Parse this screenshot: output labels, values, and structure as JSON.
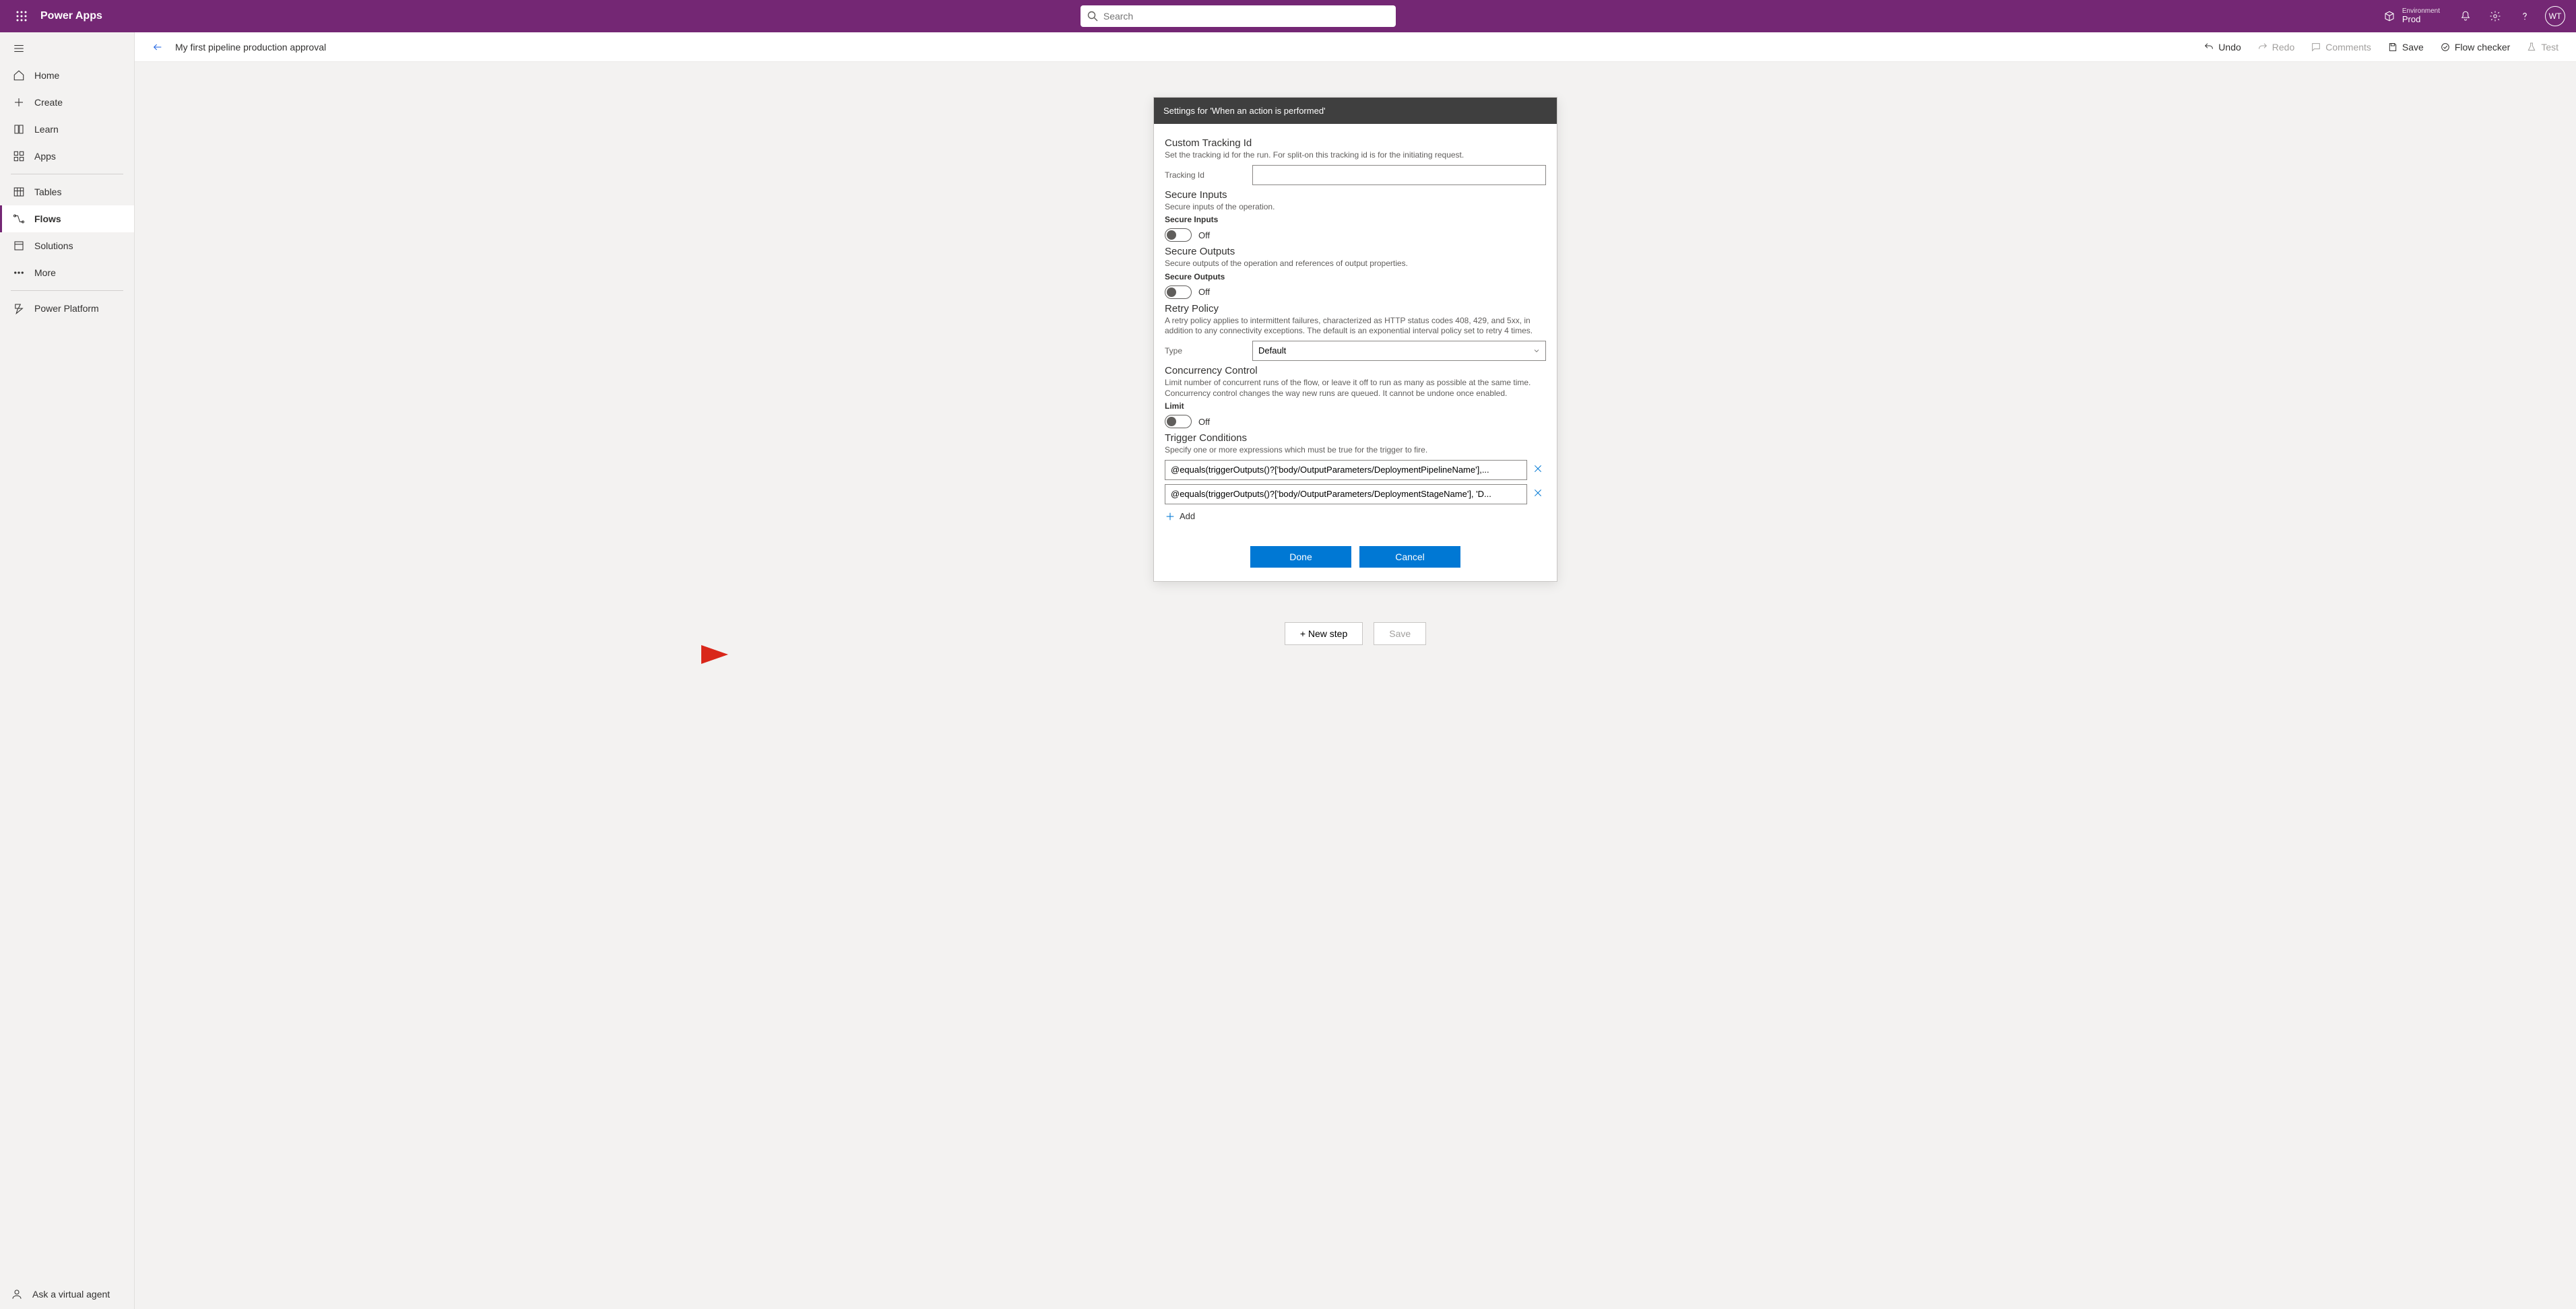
{
  "header": {
    "brand": "Power Apps",
    "search_placeholder": "Search",
    "env_label": "Environment",
    "env_name": "Prod",
    "avatar_initials": "WT"
  },
  "sidebar": {
    "items": [
      {
        "id": "home",
        "label": "Home"
      },
      {
        "id": "create",
        "label": "Create"
      },
      {
        "id": "learn",
        "label": "Learn"
      },
      {
        "id": "apps",
        "label": "Apps"
      },
      {
        "id": "tables",
        "label": "Tables"
      },
      {
        "id": "flows",
        "label": "Flows"
      },
      {
        "id": "solutions",
        "label": "Solutions"
      },
      {
        "id": "more",
        "label": "More"
      },
      {
        "id": "powerplat",
        "label": "Power Platform"
      }
    ],
    "footer_label": "Ask a virtual agent"
  },
  "command_bar": {
    "page_title": "My first pipeline production approval",
    "undo": "Undo",
    "redo": "Redo",
    "comments": "Comments",
    "save": "Save",
    "flow_checker": "Flow checker",
    "test": "Test"
  },
  "settings": {
    "card_title": "Settings for 'When an action is performed'",
    "tracking": {
      "title": "Custom Tracking Id",
      "desc": "Set the tracking id for the run. For split-on this tracking id is for the initiating request.",
      "field_label": "Tracking Id",
      "value": ""
    },
    "secure_inputs": {
      "title": "Secure Inputs",
      "desc": "Secure inputs of the operation.",
      "sub_label": "Secure Inputs",
      "state": "Off"
    },
    "secure_outputs": {
      "title": "Secure Outputs",
      "desc": "Secure outputs of the operation and references of output properties.",
      "sub_label": "Secure Outputs",
      "state": "Off"
    },
    "retry": {
      "title": "Retry Policy",
      "desc": "A retry policy applies to intermittent failures, characterized as HTTP status codes 408, 429, and 5xx, in addition to any connectivity exceptions. The default is an exponential interval policy set to retry 4 times.",
      "field_label": "Type",
      "value": "Default"
    },
    "concurrency": {
      "title": "Concurrency Control",
      "desc": "Limit number of concurrent runs of the flow, or leave it off to run as many as possible at the same time. Concurrency control changes the way new runs are queued. It cannot be undone once enabled.",
      "sub_label": "Limit",
      "state": "Off"
    },
    "trigger": {
      "title": "Trigger Conditions",
      "desc": "Specify one or more expressions which must be true for the trigger to fire.",
      "conditions": [
        "@equals(triggerOutputs()?['body/OutputParameters/DeploymentPipelineName'],...",
        "@equals(triggerOutputs()?['body/OutputParameters/DeploymentStageName'], 'D..."
      ],
      "add_label": "Add"
    },
    "buttons": {
      "done": "Done",
      "cancel": "Cancel"
    }
  },
  "bottom": {
    "new_step": "+ New step",
    "save": "Save"
  }
}
